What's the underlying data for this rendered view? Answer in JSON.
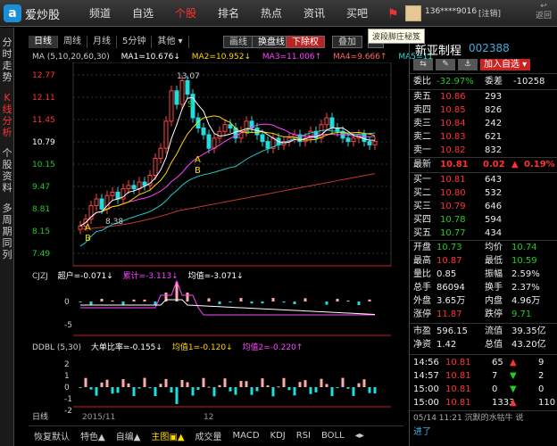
{
  "app": {
    "logo_text": "爱炒股",
    "logo_mark": "a"
  },
  "nav": [
    "频道",
    "自选",
    "个股",
    "排名",
    "热点",
    "资讯",
    "买吧"
  ],
  "nav_active": 2,
  "user": {
    "id": "136****9016",
    "logout": "[注销]",
    "back": "返回",
    "tooltip": "波段脚庄秘笈"
  },
  "leftnav": [
    "分时走势",
    "K线分析",
    "个股资料",
    "多周期同列"
  ],
  "chart_tabs": [
    "日线",
    "周线",
    "月线",
    "5分钟",
    "其他 ▾"
  ],
  "chart_buttons": {
    "draw": "画线",
    "vol": "换盘线",
    "rights": "下除权",
    "overlay": "叠加"
  },
  "ma_legend": {
    "label": "MA (5,10,20,60,30)",
    "ma1": "MA1=10.676↓",
    "ma2": "MA2=10.952↓",
    "ma3": "MA3=11.006↑",
    "ma4": "MA4=9.666↑",
    "ma5": "MA5=11"
  },
  "y_ticks": [
    "12.77",
    "12.11",
    "11.45",
    "10.79",
    "10.15",
    "9.47",
    "8.81",
    "8.15",
    "7.49"
  ],
  "annotations": {
    "high": "13.07",
    "low": "8.38"
  },
  "cjzj": {
    "title": "CJZJ",
    "a": "超户=-0.071↓",
    "b": "累计=-3.113↓",
    "c": "均值=-3.071↓",
    "ticks": [
      "0",
      "-5"
    ]
  },
  "ddbl": {
    "title": "DDBL (5,30)",
    "a": "大单比率=-0.155↓",
    "b": "均值1=-0.120↓",
    "c": "均值2=-0.220↑",
    "ticks": [
      "2",
      "1",
      "0",
      "-1",
      "-2"
    ]
  },
  "xaxis": {
    "period": "日线",
    "left": "2015/11",
    "mid": "12"
  },
  "bottom_tabs": [
    "恢复默认",
    "特色▲",
    "自编▲",
    "主图▣▲",
    "成交量",
    "MACD",
    "KDJ",
    "RSI",
    "BOLL",
    "◂▸"
  ],
  "stock": {
    "name": "新亚制程",
    "code": "002388",
    "add_fav": "加入自选 ▾"
  },
  "ratio": {
    "label1": "委比",
    "v1": "-32.97%",
    "label2": "委差",
    "v2": "-10258"
  },
  "asks": [
    {
      "label": "卖五",
      "price": "10.86",
      "vol": "293"
    },
    {
      "label": "卖四",
      "price": "10.85",
      "vol": "826"
    },
    {
      "label": "卖三",
      "price": "10.84",
      "vol": "242"
    },
    {
      "label": "卖二",
      "price": "10.83",
      "vol": "621"
    },
    {
      "label": "卖一",
      "price": "10.82",
      "vol": "832"
    }
  ],
  "latest": {
    "label": "最新",
    "price": "10.81",
    "chg": "0.02",
    "pct": "0.19%"
  },
  "bids": [
    {
      "label": "买一",
      "price": "10.81",
      "vol": "643"
    },
    {
      "label": "买二",
      "price": "10.80",
      "vol": "532"
    },
    {
      "label": "买三",
      "price": "10.79",
      "vol": "646"
    },
    {
      "label": "买四",
      "price": "10.78",
      "vol": "594"
    },
    {
      "label": "买五",
      "price": "10.77",
      "vol": "434"
    }
  ],
  "stats": [
    {
      "l1": "开盘",
      "v1": "10.73",
      "l2": "均价",
      "v2": "10.74"
    },
    {
      "l1": "最高",
      "v1": "10.87",
      "l2": "最低",
      "v2": "10.59"
    },
    {
      "l1": "量比",
      "v1": "0.85",
      "l2": "振幅",
      "v2": "2.59%"
    },
    {
      "l1": "总手",
      "v1": "86094",
      "l2": "换手",
      "v2": "2.37%"
    },
    {
      "l1": "外盘",
      "v1": "3.65万",
      "l2": "内盘",
      "v2": "4.96万"
    },
    {
      "l1": "涨停",
      "v1": "11.87",
      "l2": "跌停",
      "v2": "9.71"
    }
  ],
  "valuation": [
    {
      "l1": "市盈",
      "v1": "596.15",
      "l2": "流值",
      "v2": "39.35亿"
    },
    {
      "l1": "净资",
      "v1": "1.42",
      "l2": "总值",
      "v2": "43.20亿"
    }
  ],
  "trades": [
    {
      "time": "14:56",
      "price": "10.81",
      "vol": "65",
      "n": "9"
    },
    {
      "time": "14:57",
      "price": "10.81",
      "vol": "7",
      "n": "2"
    },
    {
      "time": "15:00",
      "price": "10.81",
      "vol": "0",
      "n": "0"
    },
    {
      "time": "15:00",
      "price": "10.81",
      "vol": "1333",
      "n": "110"
    }
  ],
  "news": {
    "line": "05/14 11:21  沉默的水牯牛 说",
    "link": "进了"
  }
}
